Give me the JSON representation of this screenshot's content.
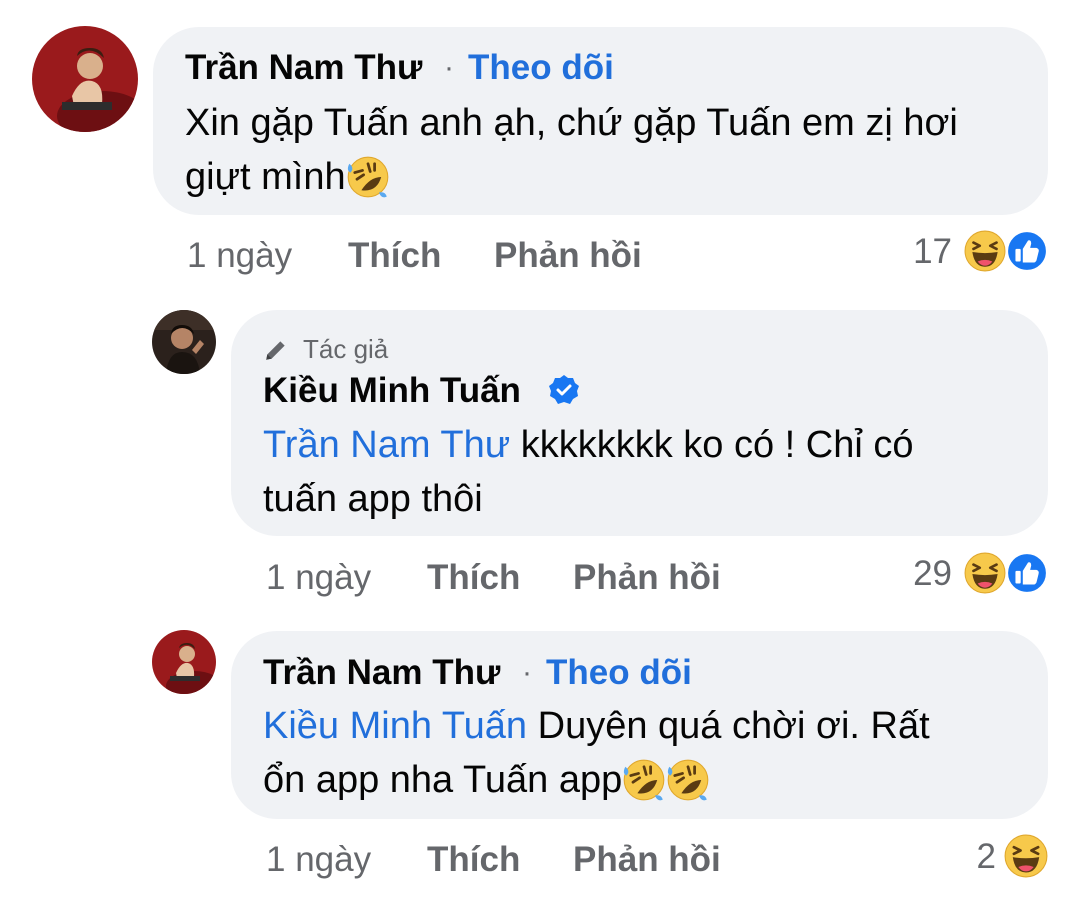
{
  "comments": [
    {
      "author": "Trần Nam Thư",
      "separator": "·",
      "follow_label": "Theo dõi",
      "text_line1": "Xin gặp Tuấn anh ạh, chứ gặp Tuấn em zị hơi",
      "text_line2": "giựt mình",
      "time": "1 ngày",
      "like_label": "Thích",
      "reply_label": "Phản hồi",
      "reaction_count": "17",
      "reactions": [
        "haha-icon",
        "like-icon"
      ]
    },
    {
      "badge_label": "Tác giả",
      "author": "Kiều Minh Tuấn",
      "verified": "verified-icon",
      "mention": "Trần Nam Thư",
      "text_line1_rest": " kkkkkkkk ko có ! Chỉ có",
      "text_line2": "tuấn app thôi",
      "time": "1 ngày",
      "like_label": "Thích",
      "reply_label": "Phản hồi",
      "reaction_count": "29",
      "reactions": [
        "haha-icon",
        "like-icon"
      ]
    },
    {
      "author": "Trần Nam Thư",
      "separator": "·",
      "follow_label": "Theo dõi",
      "mention": "Kiều Minh Tuấn",
      "text_line1_rest": " Duyên quá chời ơi. Rất",
      "text_line2": "ổn app nha Tuấn app",
      "time": "1 ngày",
      "like_label": "Thích",
      "reply_label": "Phản hồi",
      "reaction_count": "2",
      "reactions": [
        "haha-icon"
      ]
    }
  ],
  "colors": {
    "bubble": "#f0f2f5",
    "link": "#216fdb",
    "meta": "#65676b",
    "like_blue": "#1877f2",
    "haha_yellow": "#f7c94b"
  }
}
